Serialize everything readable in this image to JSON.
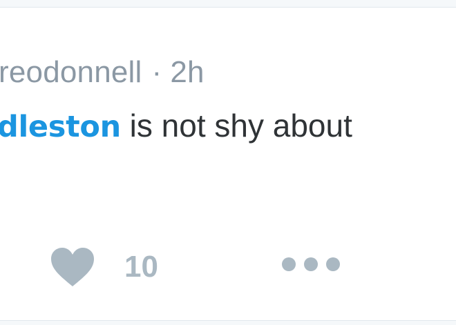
{
  "tweet": {
    "handle_fragment": "reodonnell",
    "separator": "·",
    "timestamp": "2h",
    "mention": "dleston",
    "text_after_mention": " is not shy about",
    "like_count": "10"
  },
  "icons": {
    "like": "heart-icon",
    "more": "more-dots-icon"
  },
  "colors": {
    "mention": "#1b95e0",
    "meta_text": "#8b98a4",
    "body_text": "#2f3336",
    "icon_gray": "#aab8c2"
  }
}
